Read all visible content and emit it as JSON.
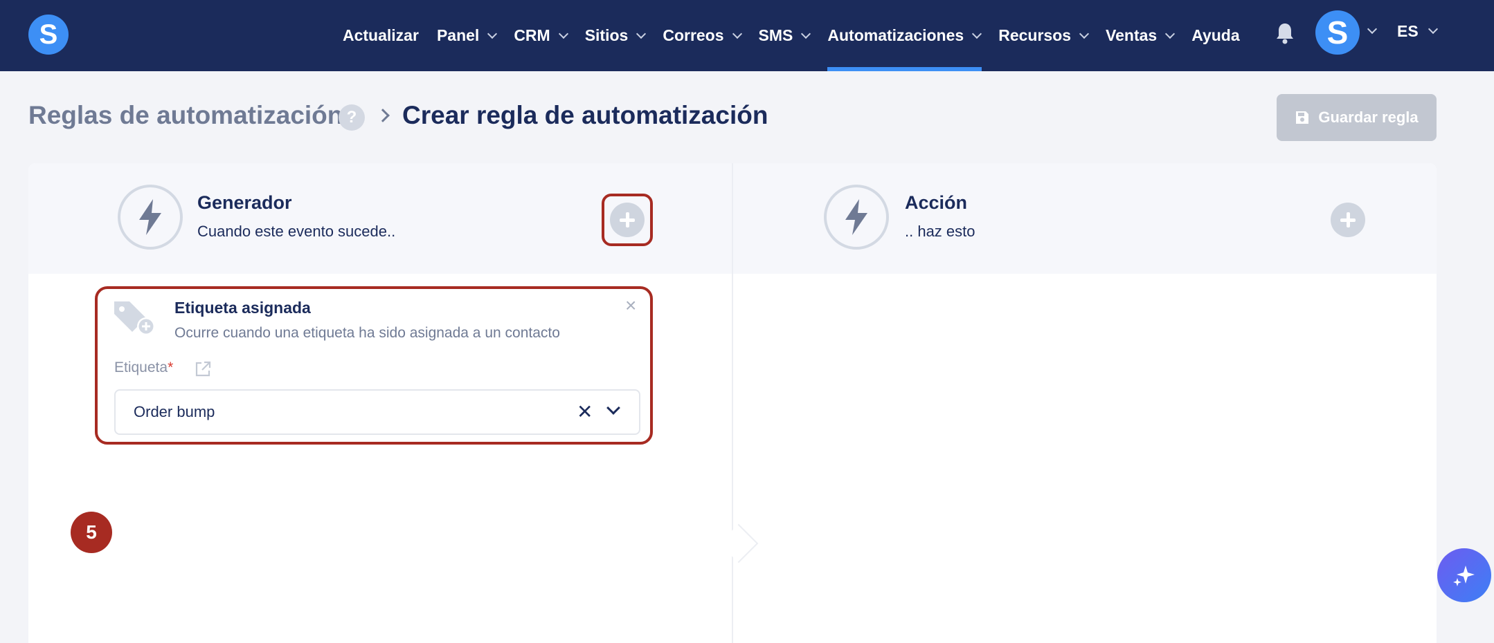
{
  "nav": {
    "items": [
      {
        "label": "Actualizar",
        "dropdown": false,
        "active": false
      },
      {
        "label": "Panel",
        "dropdown": true,
        "active": false
      },
      {
        "label": "CRM",
        "dropdown": true,
        "active": false
      },
      {
        "label": "Sitios",
        "dropdown": true,
        "active": false
      },
      {
        "label": "Correos",
        "dropdown": true,
        "active": false
      },
      {
        "label": "SMS",
        "dropdown": true,
        "active": false
      },
      {
        "label": "Automatizaciones",
        "dropdown": true,
        "active": true
      },
      {
        "label": "Recursos",
        "dropdown": true,
        "active": false
      },
      {
        "label": "Ventas",
        "dropdown": true,
        "active": false
      },
      {
        "label": "Ayuda",
        "dropdown": false,
        "active": false
      }
    ],
    "logo_letter": "S",
    "avatar_letter": "S",
    "language": "ES",
    "icons": [
      "bell-icon"
    ]
  },
  "header": {
    "breadcrumb_root": "Reglas de automatización",
    "help_mark": "?",
    "breadcrumb_current": "Crear regla de automatización",
    "save_label": "Guardar regla"
  },
  "generator": {
    "title": "Generador",
    "subtitle": "Cuando este evento sucede.."
  },
  "action": {
    "title": "Acción",
    "subtitle": ".. haz esto"
  },
  "trigger": {
    "title": "Etiqueta asignada",
    "description": "Ocurre cuando una etiqueta ha sido asignada a un contacto",
    "close_mark": "×",
    "field_label": "Etiqueta",
    "required_mark": "*",
    "value": "Order bump",
    "clear_mark": "✕"
  },
  "step_badge": "5",
  "colors": {
    "topbar": "#1b2b5b",
    "accent": "#3d8ff5",
    "highlight": "#a72b22"
  }
}
